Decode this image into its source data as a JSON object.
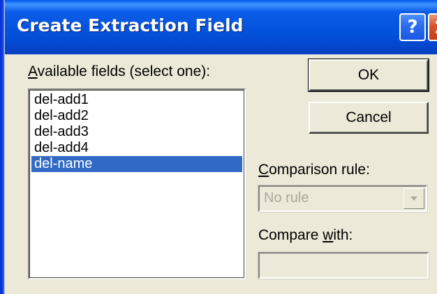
{
  "window": {
    "title": "Create Extraction Field",
    "help_label": "?",
    "close_label": "X"
  },
  "available_fields": {
    "label_accel": "A",
    "label_rest": "vailable fields (select one):",
    "items": [
      "del-add1",
      "del-add2",
      "del-add3",
      "del-add4",
      "del-name"
    ],
    "selected_index": 4
  },
  "buttons": {
    "ok_label": "OK",
    "cancel_label": "Cancel"
  },
  "comparison_rule": {
    "label_accel": "C",
    "label_rest": "omparison rule:",
    "value": "No rule",
    "enabled": false
  },
  "compare_with": {
    "label_pre": "Compare ",
    "label_accel": "w",
    "label_rest": "ith:",
    "value": "",
    "enabled": false
  },
  "colors": {
    "titlebar": "#0453dd",
    "dialog_bg": "#ece9d8",
    "selection": "#316ac5",
    "close_button": "#d8542e",
    "disabled_text": "#aca899"
  },
  "icons": {
    "help": "question-mark-icon",
    "close": "close-x-icon",
    "dropdown": "chevron-down-icon"
  }
}
